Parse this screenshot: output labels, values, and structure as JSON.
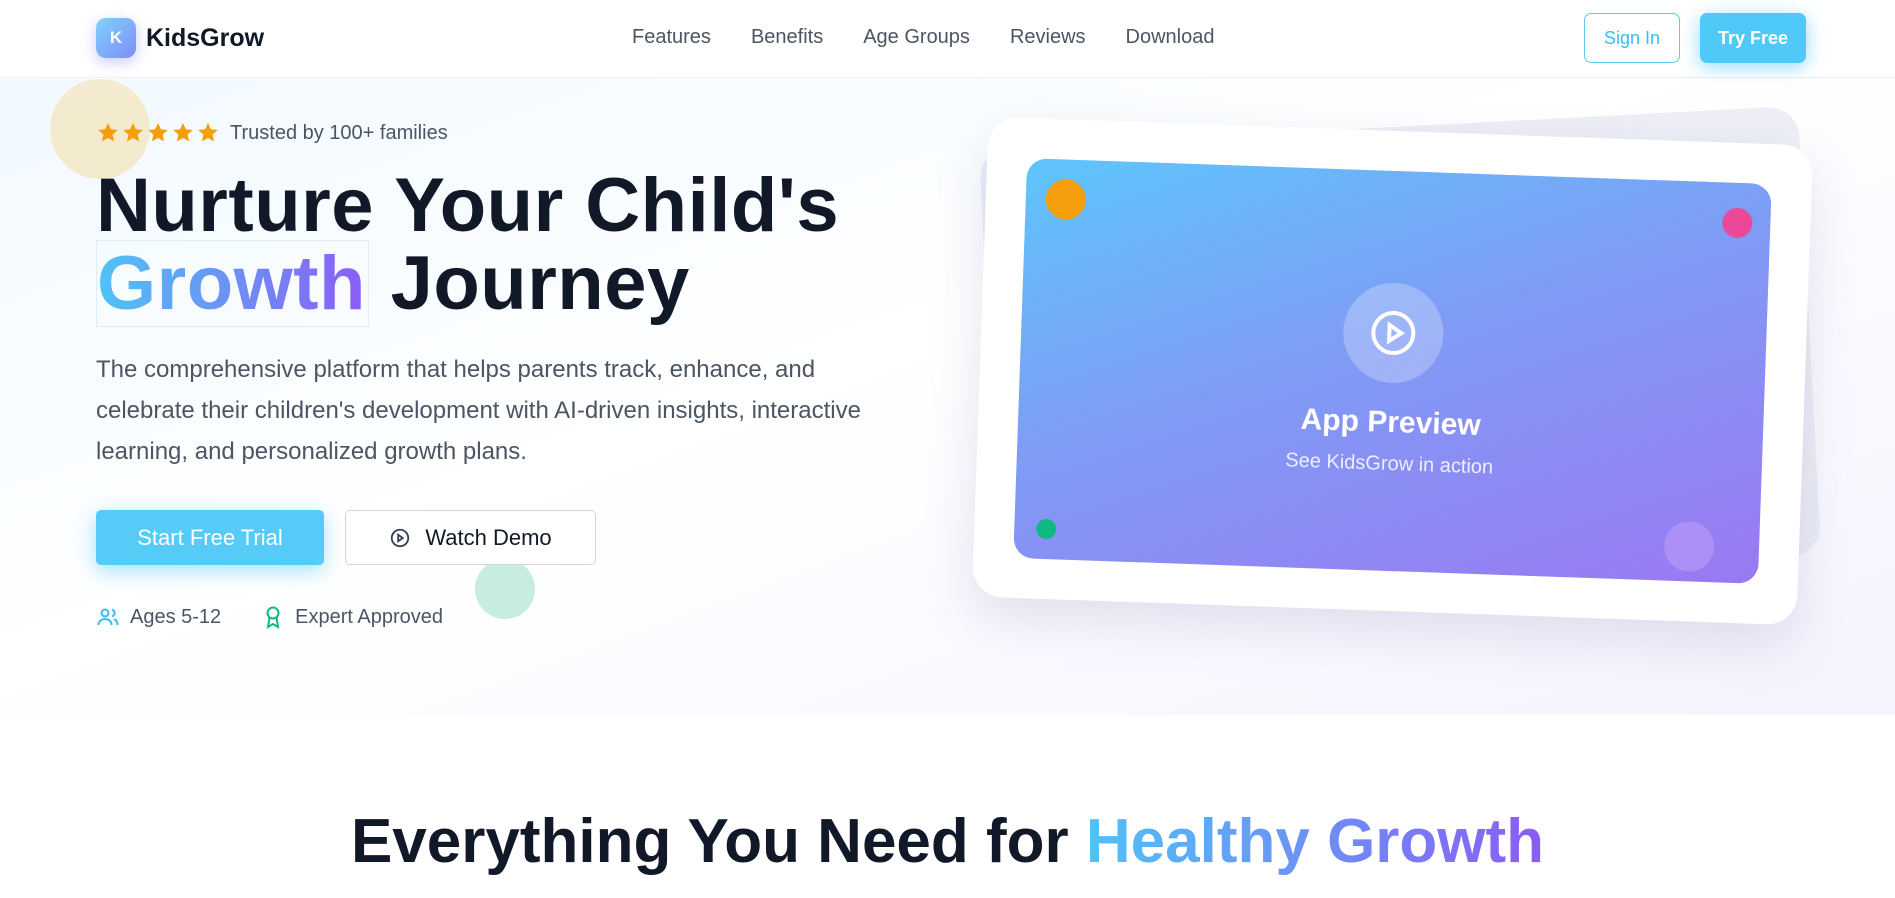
{
  "brand": {
    "logo_letter": "K",
    "name": "KidsGrow",
    "accent": "#4fc9f7",
    "gradient": [
      "#4fc3f7",
      "#8b5cf6"
    ]
  },
  "nav": {
    "links": [
      "Features",
      "Benefits",
      "Age Groups",
      "Reviews",
      "Download"
    ],
    "sign_in": "Sign In",
    "try_free": "Try Free"
  },
  "hero": {
    "rating": {
      "stars": 5,
      "text": "Trusted by 100+ families"
    },
    "headline_line1": "Nurture Your Child's",
    "headline_highlight": "Growth",
    "headline_rest": "Journey",
    "subtext": "The comprehensive platform that helps parents track, enhance, and celebrate their children's development with AI-driven insights, interactive learning, and personalized growth plans.",
    "primary_cta": "Start Free Trial",
    "secondary_cta": "Watch Demo",
    "badges": [
      {
        "icon": "users-icon",
        "label": "Ages 5-12"
      },
      {
        "icon": "award-icon",
        "label": "Expert Approved"
      }
    ]
  },
  "preview": {
    "title": "App Preview",
    "subtitle": "See KidsGrow in action"
  },
  "features_section": {
    "title_prefix": "Everything You Need for ",
    "title_highlight": "Healthy Growth"
  }
}
